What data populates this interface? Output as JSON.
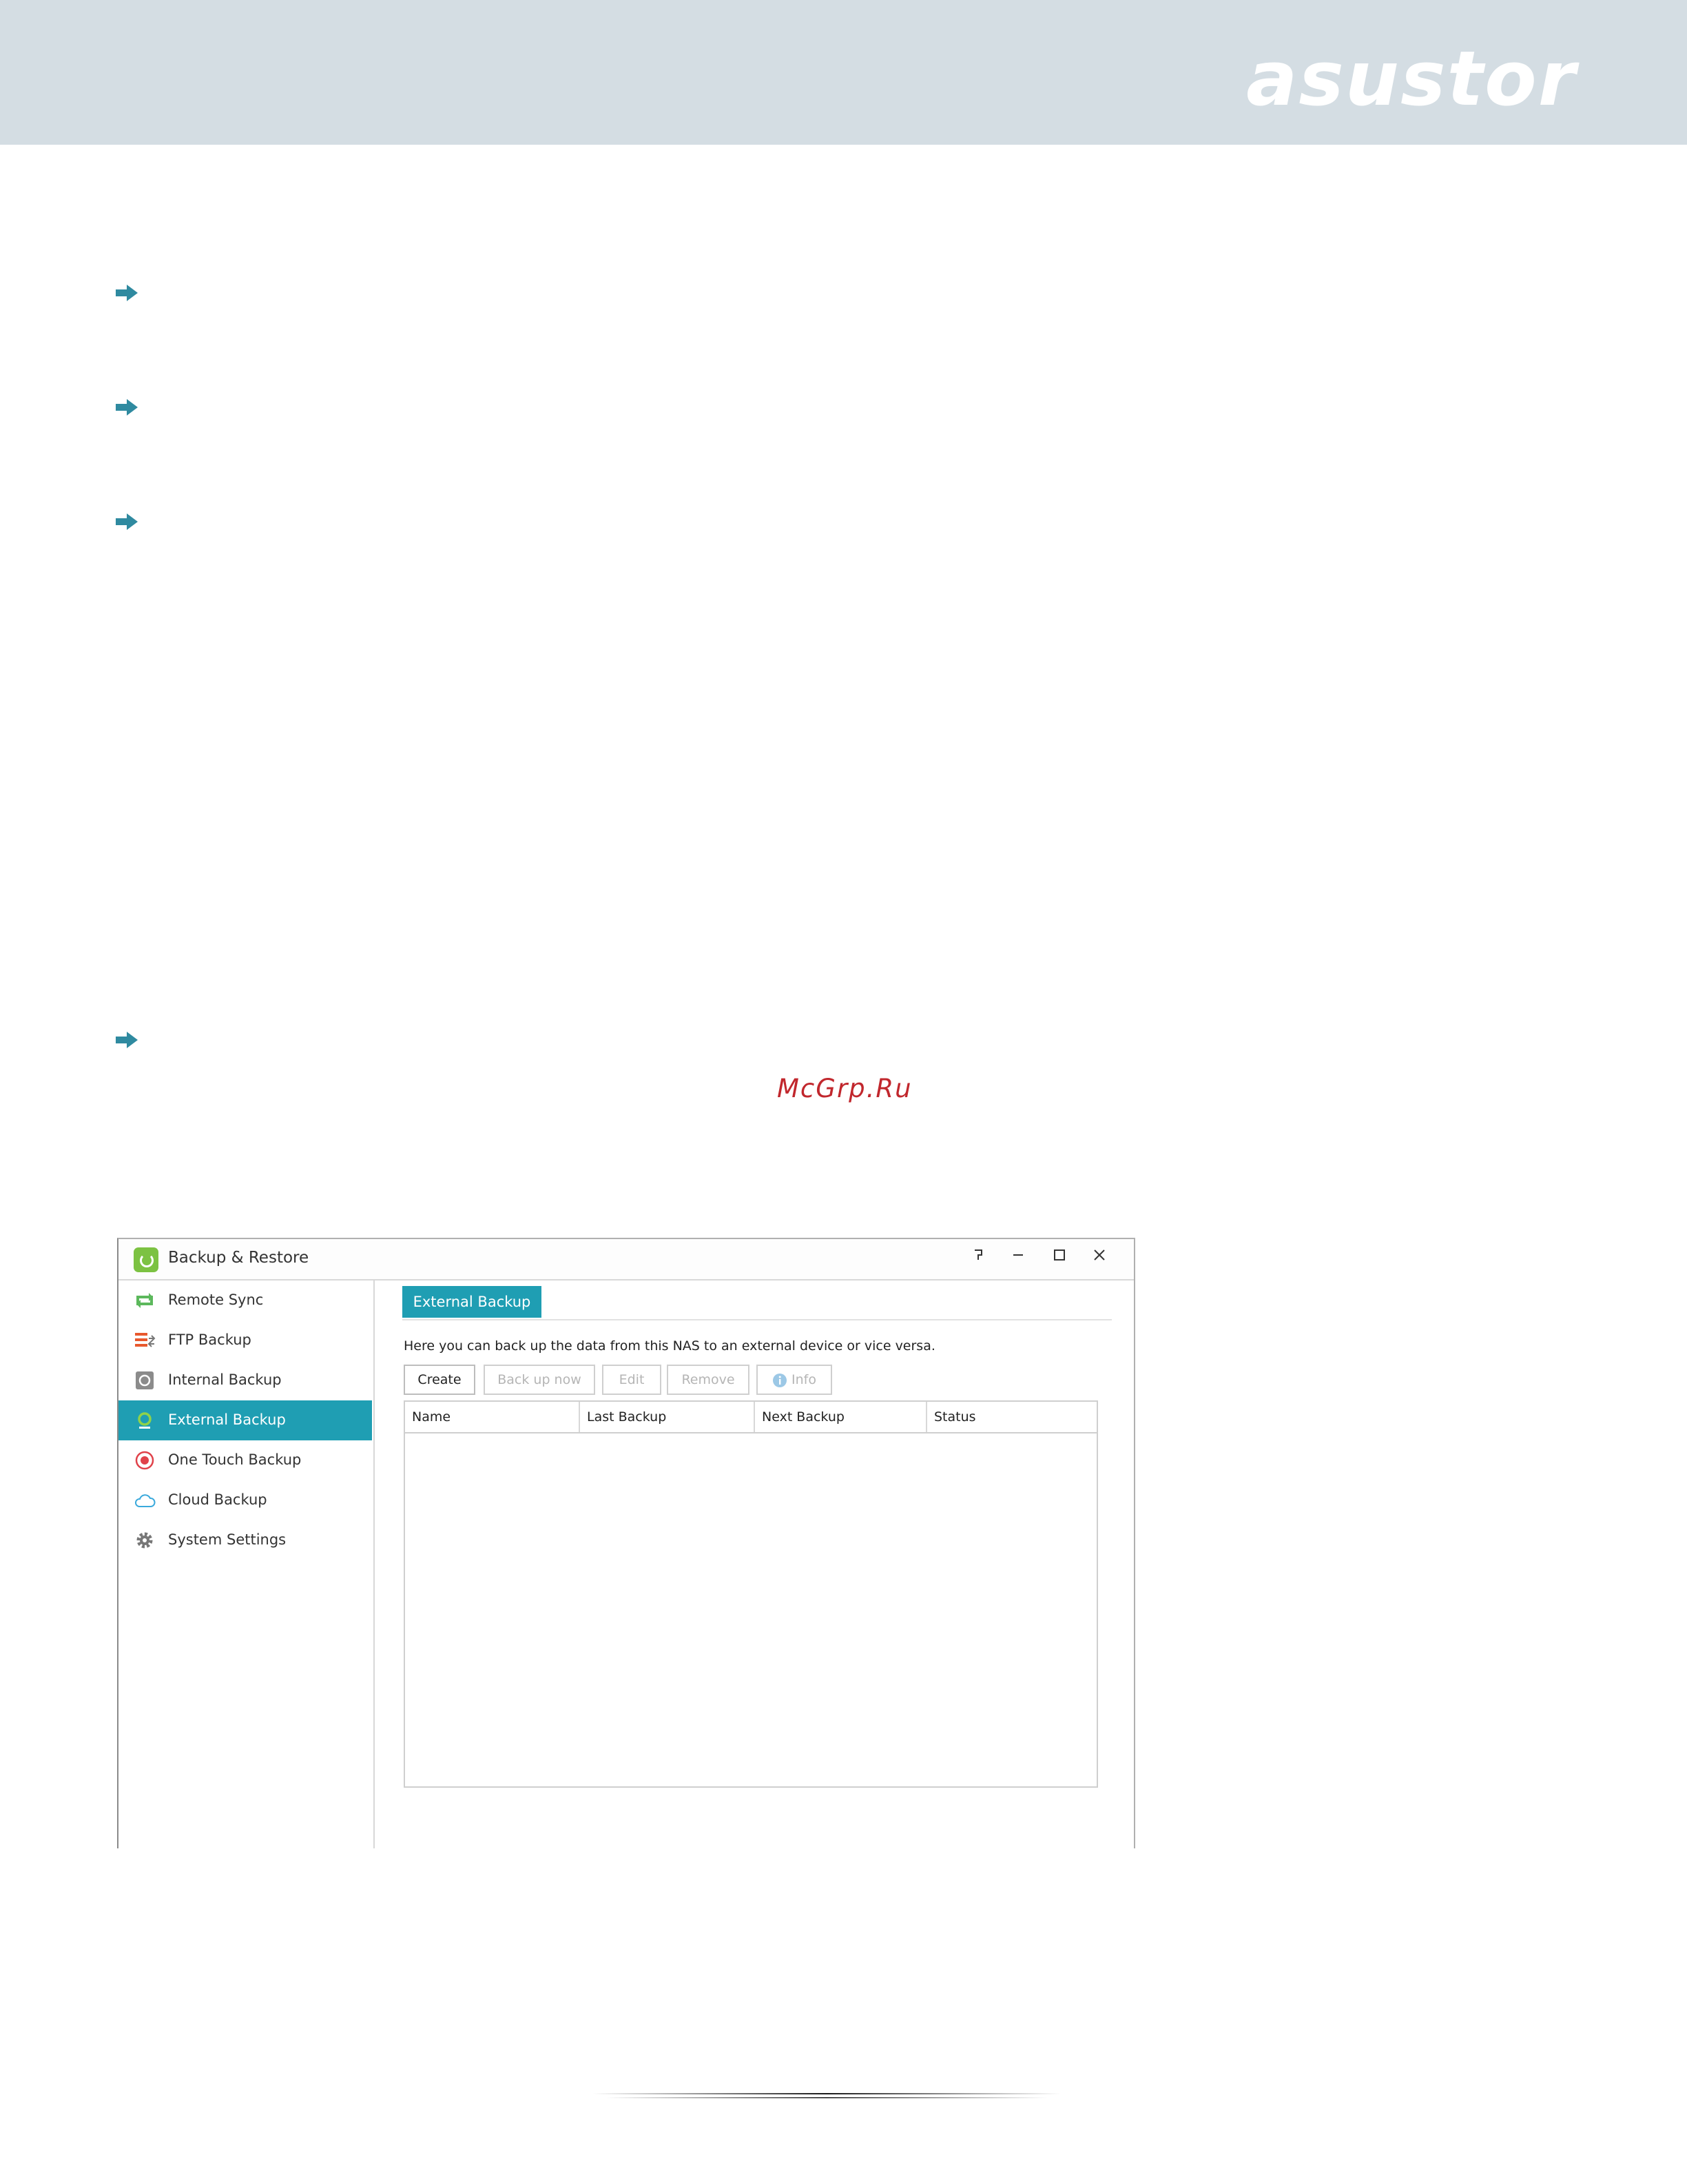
{
  "header": {
    "brand_logo": "asustor",
    "background_color": "#d4dde3"
  },
  "watermark": "McGrp.Ru",
  "app_window": {
    "title": "Backup & Restore",
    "controls": [
      "help-icon",
      "minimize-icon",
      "maximize-icon",
      "close-icon"
    ],
    "sidebar": {
      "items": [
        {
          "label": "Remote Sync",
          "icon": "remote-sync-icon"
        },
        {
          "label": "FTP Backup",
          "icon": "ftp-backup-icon"
        },
        {
          "label": "Internal Backup",
          "icon": "internal-backup-icon"
        },
        {
          "label": "External Backup",
          "icon": "external-backup-icon",
          "active": true
        },
        {
          "label": "One Touch Backup",
          "icon": "one-touch-backup-icon"
        },
        {
          "label": "Cloud Backup",
          "icon": "cloud-backup-icon"
        },
        {
          "label": "System Settings",
          "icon": "gear-icon"
        }
      ]
    },
    "main": {
      "tab_label": "External Backup",
      "description": "Here you can back up the data from this NAS to an external device or vice versa.",
      "toolbar": {
        "create": "Create",
        "back_up_now": "Back up now",
        "edit": "Edit",
        "remove": "Remove",
        "info": "Info"
      },
      "table": {
        "columns": [
          "Name",
          "Last Backup",
          "Next Backup",
          "Status"
        ],
        "rows": []
      }
    },
    "accent_color": "#1f9eb3"
  }
}
